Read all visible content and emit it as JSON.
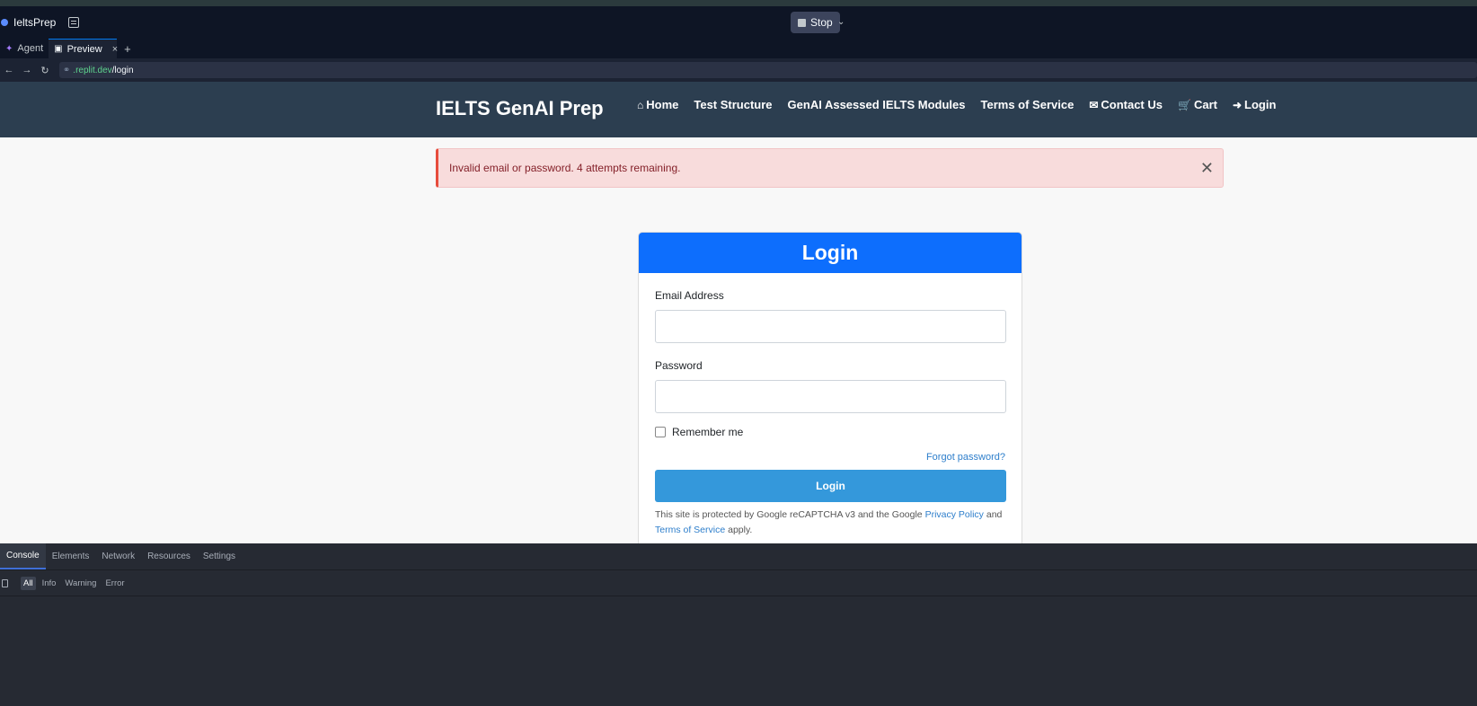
{
  "chrome": {
    "app_name": "IeltsPrep",
    "stop_label": "Stop",
    "tabs": [
      {
        "label": "Agent"
      },
      {
        "label": "Preview"
      }
    ],
    "url_host": ".replit.dev",
    "url_path": "/login"
  },
  "site": {
    "brand": "IELTS GenAI Prep",
    "nav": [
      {
        "label": "Home",
        "icon": "home-icon"
      },
      {
        "label": "Test Structure"
      },
      {
        "label": "GenAI Assessed IELTS Modules"
      },
      {
        "label": "Terms of Service"
      },
      {
        "label": "Contact Us",
        "icon": "envelope-icon"
      },
      {
        "label": "Cart",
        "icon": "cart-icon"
      },
      {
        "label": "Login",
        "icon": "sign-in-icon"
      }
    ],
    "alert": "Invalid email or password. 4 attempts remaining.",
    "login": {
      "title": "Login",
      "email_label": "Email Address",
      "email_value": "",
      "password_label": "Password",
      "password_value": "",
      "remember_label": "Remember me",
      "forgot_label": "Forgot password?",
      "submit_label": "Login",
      "captcha_prefix": "This site is protected by Google reCAPTCHA v3 and the Google ",
      "privacy_label": "Privacy Policy",
      "captcha_and": " and",
      "terms_label": "Terms of Service",
      "captcha_suffix": " apply."
    }
  },
  "devtools": {
    "tabs": [
      "Console",
      "Elements",
      "Network",
      "Resources",
      "Settings"
    ],
    "filters": [
      "All",
      "Info",
      "Warning",
      "Error"
    ]
  },
  "colors": {
    "nav_bg": "#2c3e50",
    "card_header": "#0d6efd",
    "login_button": "#3498db",
    "alert_bg": "#f8dcdc",
    "alert_border": "#e74c3c"
  }
}
